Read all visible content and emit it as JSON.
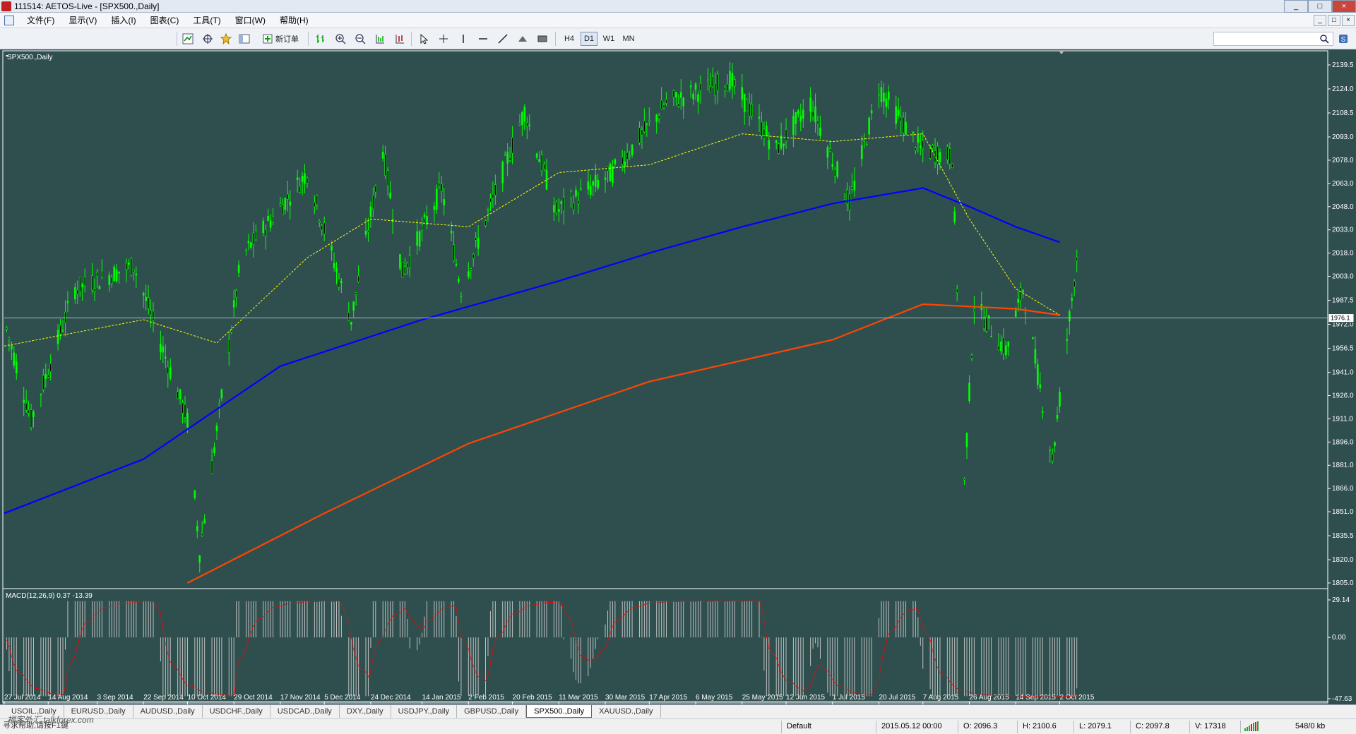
{
  "window": {
    "title": "111514: AETOS-Live - [SPX500.,Daily]",
    "min": "_",
    "max": "□",
    "close": "×"
  },
  "menu": [
    {
      "label": "文件(F)"
    },
    {
      "label": "显示(V)"
    },
    {
      "label": "插入(I)"
    },
    {
      "label": "图表(C)"
    },
    {
      "label": "工具(T)"
    },
    {
      "label": "窗口(W)"
    },
    {
      "label": "帮助(H)"
    }
  ],
  "toolbar": {
    "new_order_label": "新订单",
    "timeframes": [
      "H4",
      "D1",
      "W1",
      "MN"
    ],
    "active_timeframe": "D1",
    "search_placeholder": ""
  },
  "chart_data": {
    "type": "candlestick",
    "title": "SPX500.,Daily",
    "symbol": "SPX500.",
    "timeframe": "Daily",
    "current_price": "1976.1",
    "price_ticks": [
      "2139.5",
      "2124.0",
      "2108.5",
      "2093.0",
      "2078.0",
      "2063.0",
      "2048.0",
      "2033.0",
      "2018.0",
      "2003.0",
      "1987.5",
      "1972.0",
      "1956.5",
      "1941.0",
      "1926.0",
      "1911.0",
      "1896.0",
      "1881.0",
      "1866.0",
      "1851.0",
      "1835.5",
      "1820.0",
      "1805.0"
    ],
    "ylim": [
      1805.0,
      2139.5
    ],
    "x_ticks": [
      "27 Jul 2014",
      "14 Aug 2014",
      "3 Sep 2014",
      "22 Sep 2014",
      "10 Oct 2014",
      "29 Oct 2014",
      "17 Nov 2014",
      "5 Dec 2014",
      "24 Dec 2014",
      "14 Jan 2015",
      "2 Feb 2015",
      "20 Feb 2015",
      "11 Mar 2015",
      "30 Mar 2015",
      "17 Apr 2015",
      "6 May 2015",
      "25 May 2015",
      "12 Jun 2015",
      "1 Jul 2015",
      "20 Jul 2015",
      "7 Aug 2015",
      "26 Aug 2015",
      "14 Sep 2015",
      "2 Oct 2015"
    ],
    "price_key_points": [
      {
        "date": "27 Jul 2014",
        "close": 1975
      },
      {
        "date": "7 Aug 2014",
        "close": 1910
      },
      {
        "date": "25 Aug 2014",
        "close": 1995
      },
      {
        "date": "18 Sep 2014",
        "close": 2010
      },
      {
        "date": "10 Oct 2014",
        "close": 1910
      },
      {
        "date": "15 Oct 2014",
        "close": 1825
      },
      {
        "date": "1 Nov 2014",
        "close": 2015
      },
      {
        "date": "28 Nov 2014",
        "close": 2070
      },
      {
        "date": "16 Dec 2014",
        "close": 1975
      },
      {
        "date": "29 Dec 2014",
        "close": 2085
      },
      {
        "date": "6 Jan 2015",
        "close": 2005
      },
      {
        "date": "22 Jan 2015",
        "close": 2060
      },
      {
        "date": "30 Jan 2015",
        "close": 1995
      },
      {
        "date": "25 Feb 2015",
        "close": 2110
      },
      {
        "date": "10 Mar 2015",
        "close": 2045
      },
      {
        "date": "2 Apr 2015",
        "close": 2070
      },
      {
        "date": "24 Apr 2015",
        "close": 2115
      },
      {
        "date": "20 May 2015",
        "close": 2130
      },
      {
        "date": "8 Jun 2015",
        "close": 2085
      },
      {
        "date": "22 Jun 2015",
        "close": 2115
      },
      {
        "date": "8 Jul 2015",
        "close": 2050
      },
      {
        "date": "20 Jul 2015",
        "close": 2125
      },
      {
        "date": "6 Aug 2015",
        "close": 2085
      },
      {
        "date": "19 Aug 2015",
        "close": 2080
      },
      {
        "date": "24 Aug 2015",
        "close": 1870
      },
      {
        "date": "28 Aug 2015",
        "close": 1985
      },
      {
        "date": "10 Sep 2015",
        "close": 1955
      },
      {
        "date": "17 Sep 2015",
        "close": 1995
      },
      {
        "date": "29 Sep 2015",
        "close": 1885
      },
      {
        "date": "9 Oct 2015",
        "close": 2015
      }
    ],
    "ma_fast_yellow": [
      {
        "date": "27 Jul 2014",
        "value": 1958
      },
      {
        "date": "22 Sep 2014",
        "value": 1975
      },
      {
        "date": "22 Oct 2014",
        "value": 1960
      },
      {
        "date": "28 Nov 2014",
        "value": 2015
      },
      {
        "date": "24 Dec 2014",
        "value": 2040
      },
      {
        "date": "2 Feb 2015",
        "value": 2035
      },
      {
        "date": "11 Mar 2015",
        "value": 2070
      },
      {
        "date": "17 Apr 2015",
        "value": 2075
      },
      {
        "date": "25 May 2015",
        "value": 2095
      },
      {
        "date": "1 Jul 2015",
        "value": 2090
      },
      {
        "date": "7 Aug 2015",
        "value": 2095
      },
      {
        "date": "26 Aug 2015",
        "value": 2040
      },
      {
        "date": "14 Sep 2015",
        "value": 1995
      },
      {
        "date": "2 Oct 2015",
        "value": 1978
      }
    ],
    "ma_mid_blue": [
      {
        "date": "27 Jul 2014",
        "value": 1850
      },
      {
        "date": "22 Sep 2014",
        "value": 1885
      },
      {
        "date": "17 Nov 2014",
        "value": 1945
      },
      {
        "date": "14 Jan 2015",
        "value": 1975
      },
      {
        "date": "11 Mar 2015",
        "value": 2000
      },
      {
        "date": "17 Apr 2015",
        "value": 2018
      },
      {
        "date": "25 May 2015",
        "value": 2035
      },
      {
        "date": "1 Jul 2015",
        "value": 2050
      },
      {
        "date": "7 Aug 2015",
        "value": 2060
      },
      {
        "date": "26 Aug 2015",
        "value": 2048
      },
      {
        "date": "14 Sep 2015",
        "value": 2035
      },
      {
        "date": "2 Oct 2015",
        "value": 2025
      }
    ],
    "ma_slow_red": [
      {
        "date": "10 Oct 2014",
        "value": 1805
      },
      {
        "date": "5 Dec 2014",
        "value": 1850
      },
      {
        "date": "2 Feb 2015",
        "value": 1895
      },
      {
        "date": "17 Apr 2015",
        "value": 1935
      },
      {
        "date": "1 Jul 2015",
        "value": 1962
      },
      {
        "date": "7 Aug 2015",
        "value": 1985
      },
      {
        "date": "14 Sep 2015",
        "value": 1982
      },
      {
        "date": "2 Oct 2015",
        "value": 1978
      }
    ],
    "macd": {
      "label": "MACD(12,26,9) 0.37 -13.39",
      "main": 0.37,
      "signal": -13.39,
      "ticks": [
        "29.14",
        "0.00",
        "-47.63"
      ],
      "ylim": [
        -47.63,
        29.14
      ]
    },
    "colors": {
      "background": "#2f4f4f",
      "bull": "#00ff00",
      "ma_fast": "#ffff00",
      "ma_mid": "#0000ff",
      "ma_slow": "#ff4500",
      "macd_hist": "#c0c0c0",
      "macd_signal": "#ff0000",
      "axis_text": "#ffffff"
    }
  },
  "tabs": [
    {
      "label": "USOIL.,Daily",
      "active": false
    },
    {
      "label": "EURUSD.,Daily",
      "active": false
    },
    {
      "label": "AUDUSD.,Daily",
      "active": false
    },
    {
      "label": "USDCHF.,Daily",
      "active": false
    },
    {
      "label": "USDCAD.,Daily",
      "active": false
    },
    {
      "label": "DXY.,Daily",
      "active": false
    },
    {
      "label": "USDJPY.,Daily",
      "active": false
    },
    {
      "label": "GBPUSD.,Daily",
      "active": false
    },
    {
      "label": "SPX500.,Daily",
      "active": true
    },
    {
      "label": "XAUUSD.,Daily",
      "active": false
    }
  ],
  "status": {
    "help_hint": "寻求帮助,请按F1键",
    "watermark": "福客外汇 talkforex.com",
    "profile": "Default",
    "datetime": "2015.05.12 00:00",
    "open": "O: 2096.3",
    "high": "H: 2100.6",
    "low": "L: 2079.1",
    "close": "C: 2097.8",
    "volume": "V: 17318",
    "traffic": "548/0 kb"
  }
}
